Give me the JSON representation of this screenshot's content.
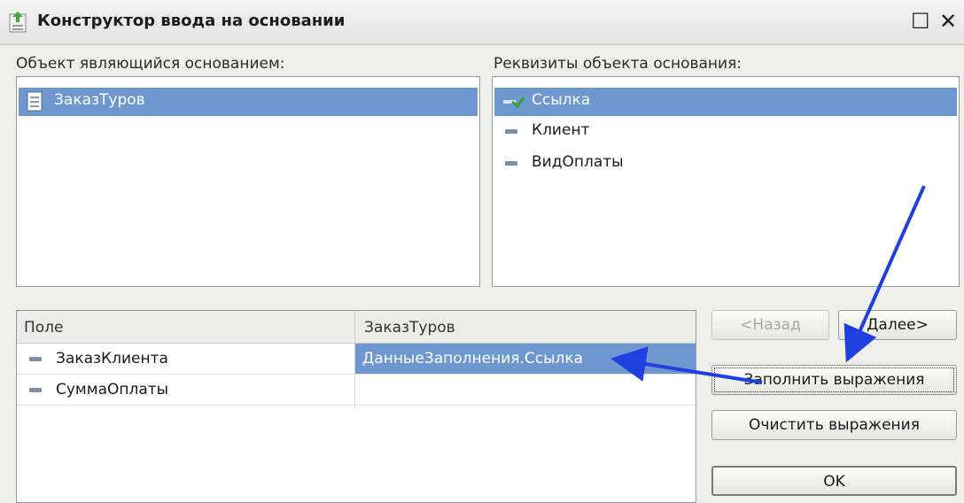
{
  "window": {
    "title": "Конструктор ввода на основании",
    "maximize_glyph": "☐",
    "close_glyph": "✕"
  },
  "left_panel": {
    "label": "Объект являющийся основанием:",
    "items": [
      {
        "label": "ЗаказТуров",
        "selected": true,
        "icon": "document-icon"
      }
    ]
  },
  "right_panel": {
    "label": "Реквизиты объекта основания:",
    "items": [
      {
        "label": "Ссылка",
        "selected": true,
        "icon": "reference-icon"
      },
      {
        "label": "Клиент",
        "selected": false,
        "icon": "attribute-icon"
      },
      {
        "label": "ВидОплаты",
        "selected": false,
        "icon": "attribute-icon"
      }
    ]
  },
  "table": {
    "columns": [
      "Поле",
      "ЗаказТуров"
    ],
    "rows": [
      {
        "field": "ЗаказКлиента",
        "expression": "ДанныеЗаполнения.Ссылка",
        "selected": true
      },
      {
        "field": "СуммаОплаты",
        "expression": "",
        "selected": false
      }
    ]
  },
  "buttons": {
    "back": "<Назад",
    "next": "Далее>",
    "fill": "Заполнить выражения",
    "clear": "Очистить выражения",
    "ok": "OK"
  },
  "colors": {
    "selection": "#6e97cf",
    "arrow": "#1f3fe0",
    "background": "#eff0ec"
  }
}
